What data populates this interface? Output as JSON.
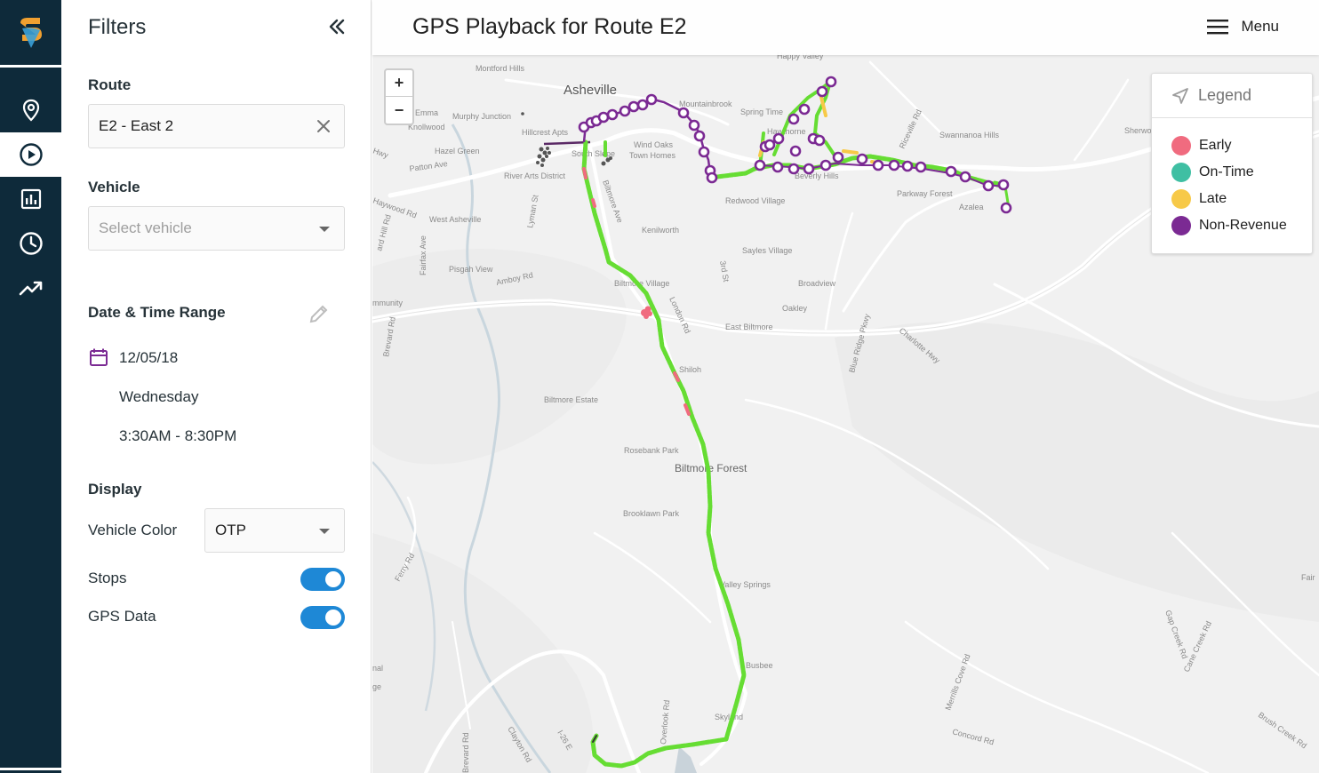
{
  "nav": {
    "items": [
      "location-pin-icon",
      "play-circle-icon",
      "bar-chart-icon",
      "clock-icon",
      "trending-up-icon"
    ],
    "active_index": 1
  },
  "filters": {
    "title": "Filters",
    "route": {
      "label": "Route",
      "value": "E2 - East 2"
    },
    "vehicle": {
      "label": "Vehicle",
      "placeholder": "Select vehicle"
    },
    "datetime": {
      "label": "Date & Time Range",
      "date": "12/05/18",
      "weekday": "Wednesday",
      "time_range": "3:30AM - 8:30PM"
    },
    "display": {
      "label": "Display",
      "vehicle_color_label": "Vehicle Color",
      "vehicle_color_value": "OTP",
      "stops_label": "Stops",
      "stops_on": true,
      "gps_label": "GPS Data",
      "gps_on": true
    }
  },
  "header": {
    "title": "GPS Playback for Route E2",
    "menu_label": "Menu"
  },
  "zoom": {
    "in": "+",
    "out": "−"
  },
  "legend": {
    "title": "Legend",
    "items": [
      {
        "label": "Early",
        "color": "#f06b7f"
      },
      {
        "label": "On-Time",
        "color": "#3fbfa3"
      },
      {
        "label": "Late",
        "color": "#f7c948"
      },
      {
        "label": "Non-Revenue",
        "color": "#7b2a93"
      }
    ]
  },
  "map_labels": {
    "asheville": "Asheville",
    "biltmore_forest": "Biltmore Forest",
    "montford_hills": "Montford Hills",
    "murphy_junction": "Murphy Junction",
    "hillcrest_apts": "Hillcrest Apts",
    "knollwood": "Knollwood",
    "emma": "Emma",
    "hazel_green": "Hazel Green",
    "patton_ave": "Patton Ave",
    "south_slope": "South Slope",
    "wind_oaks": "Wind Oaks",
    "town_homes": "Town Homes",
    "mountainbrook": "Mountainbrook",
    "spring_time": "Spring Time",
    "hawthorne": "Hawthorne",
    "beverly_hills": "Beverly Hills",
    "redwood_village": "Redwood Village",
    "parkway_forest": "Parkway Forest",
    "azalea": "Azalea",
    "swannanoa_hills": "Swannanoa Hills",
    "riceville_rd": "Riceville Rd",
    "sherwood": "Sherwood",
    "river_arts": "River Arts District",
    "haywood_rd": "Haywood Rd",
    "west_asheville": "West Asheville",
    "lyman_st": "Lyman St",
    "biltmore_ave": "Biltmore Ave",
    "kenilworth": "Kenilworth",
    "sayles_village": "Sayles Village",
    "broadview": "Broadview",
    "oakley": "Oakley",
    "east_biltmore": "East Biltmore",
    "biltmore_village": "Biltmore Village",
    "london_rd": "London Rd",
    "third_st": "3rd St",
    "pisgah_view": "Pisgah View",
    "amboy_rd": "Amboy Rd",
    "fairfax_ave": "Fairfax Ave",
    "brevard_rd": "Brevard Rd",
    "community": "mmunity",
    "shiloh": "Shiloh",
    "biltmore_estate": "Biltmore Estate",
    "blue_ridge_pkwy": "Blue Ridge Pkwy",
    "charlotte_hwy": "Charlotte Hwy",
    "rosebank_park": "Rosebank Park",
    "brooklawn_park": "Brooklawn Park",
    "valley_springs": "Valley Springs",
    "ferry_rd": "Ferry Rd",
    "busbee": "Busbee",
    "skyland": "Skyland",
    "overlook_rd": "Overlook Rd",
    "brevard_rd2": "Brevard Rd",
    "clayton_rd": "Clayton Rd",
    "i26": "I-26 E",
    "merrills_cove": "Merrills Cove Rd",
    "concord_rd": "Concord Rd",
    "gap_creek": "Gap Creek Rd",
    "cane_creek": "Cane Creek Rd",
    "brush_creek": "Brush Creek Rd",
    "nal": "nal",
    "ge": "ge",
    "fair": "Fair",
    "hwy": "Hwy",
    "happy_valley": "Happy Valley",
    "ard_hill": "ard Hill Rd"
  }
}
